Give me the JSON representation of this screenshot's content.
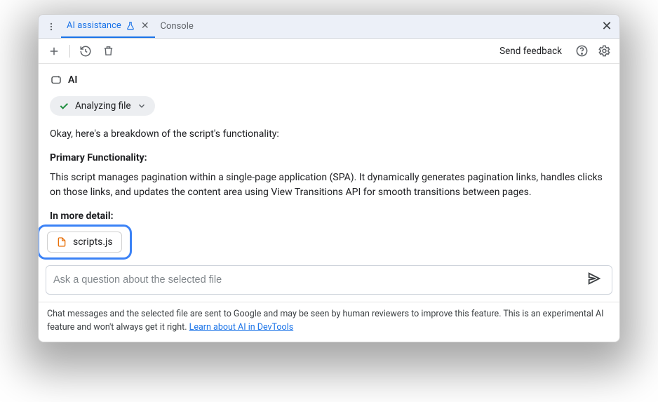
{
  "tabs": {
    "ai": "AI assistance",
    "console": "Console"
  },
  "toolbar": {
    "feedback": "Send feedback"
  },
  "ai_label": "AI",
  "status_chip": "Analyzing file",
  "body": {
    "intro": "Okay, here's a breakdown of the script's functionality:",
    "h1": "Primary Functionality:",
    "p1": "This script manages pagination within a single-page application (SPA). It dynamically generates pagination links, handles clicks on those links, and updates the content area using View Transitions API for smooth transitions between pages.",
    "h2": "In more detail:"
  },
  "file": {
    "name": "scripts.js"
  },
  "input": {
    "placeholder": "Ask a question about the selected file"
  },
  "footer": {
    "text": "Chat messages and the selected file are sent to Google and may be seen by human reviewers to improve this feature. This is an experimental AI feature and won't always get it right. ",
    "link": "Learn about AI in DevTools"
  }
}
